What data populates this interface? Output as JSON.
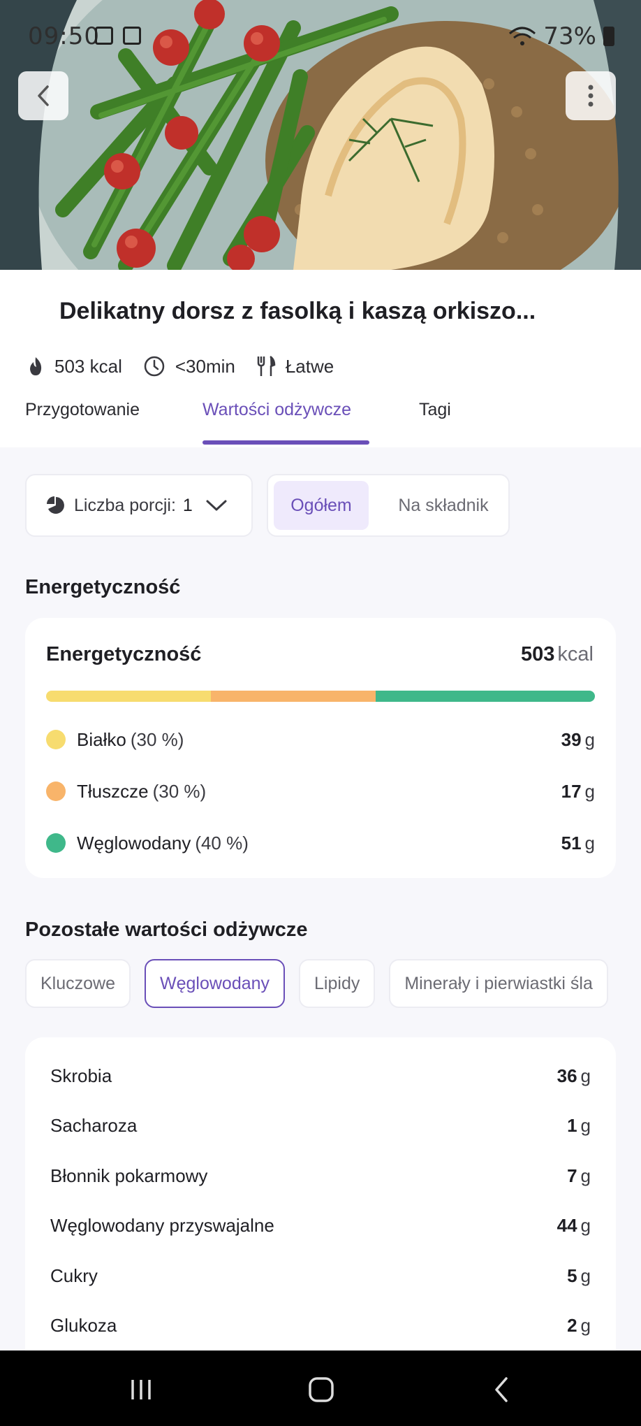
{
  "status_bar": {
    "time": "09:50",
    "battery": "73%"
  },
  "recipe": {
    "title": "Delikatny dorsz z fasolką i kaszą orkiszo...",
    "kcal": "503 kcal",
    "time": "<30min",
    "difficulty": "Łatwe"
  },
  "tabs": [
    {
      "label": "Przygotowanie",
      "active": false
    },
    {
      "label": "Wartości odżywcze",
      "active": true
    },
    {
      "label": "Tagi",
      "active": false
    }
  ],
  "controls": {
    "portions_label": "Liczba porcji:",
    "portions_value": "1",
    "segment_total": "Ogółem",
    "segment_per_ingredient": "Na składnik"
  },
  "energy": {
    "section_heading": "Energetyczność",
    "card_title": "Energetyczność",
    "value": "503",
    "unit": "kcal",
    "macros": [
      {
        "name": "Białko",
        "percent_label": "(30 %)",
        "percent": 30,
        "amount": "39",
        "unit": "g",
        "color": "#f7dc6f"
      },
      {
        "name": "Tłuszcze",
        "percent_label": "(30 %)",
        "percent": 30,
        "amount": "17",
        "unit": "g",
        "color": "#f8b46a"
      },
      {
        "name": "Węglowodany",
        "percent_label": "(40 %)",
        "percent": 40,
        "amount": "51",
        "unit": "g",
        "color": "#3fb88a"
      }
    ]
  },
  "other": {
    "section_heading": "Pozostałe wartości odżywcze",
    "chips": [
      {
        "label": "Kluczowe",
        "active": false
      },
      {
        "label": "Węglowodany",
        "active": true
      },
      {
        "label": "Lipidy",
        "active": false
      },
      {
        "label": "Minerały i pierwiastki śla",
        "active": false
      }
    ],
    "rows": [
      {
        "name": "Skrobia",
        "amount": "36",
        "unit": "g"
      },
      {
        "name": "Sacharoza",
        "amount": "1",
        "unit": "g"
      },
      {
        "name": "Błonnik pokarmowy",
        "amount": "7",
        "unit": "g"
      },
      {
        "name": "Węglowodany przyswajalne",
        "amount": "44",
        "unit": "g"
      },
      {
        "name": "Cukry",
        "amount": "5",
        "unit": "g"
      },
      {
        "name": "Glukoza",
        "amount": "2",
        "unit": "g"
      }
    ]
  },
  "colors": {
    "accent": "#6a4fb8",
    "accent_bg": "#efeafc",
    "page_bg": "#f7f7fb"
  }
}
